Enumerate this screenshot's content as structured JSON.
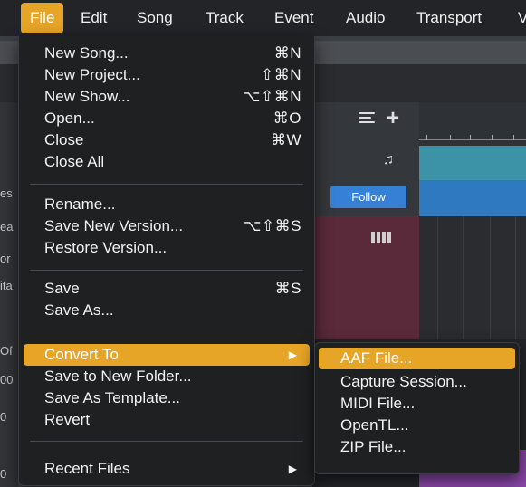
{
  "menubar": {
    "items": [
      "File",
      "Edit",
      "Song",
      "Track",
      "Event",
      "Audio",
      "Transport",
      "V"
    ],
    "active": "File"
  },
  "file_menu": {
    "items": [
      {
        "label": "New Song...",
        "shortcut": "⌘N"
      },
      {
        "label": "New Project...",
        "shortcut": "⇧⌘N"
      },
      {
        "label": "New Show...",
        "shortcut": "⌥⇧⌘N"
      },
      {
        "label": "Open...",
        "shortcut": "⌘O"
      },
      {
        "label": "Close",
        "shortcut": "⌘W"
      },
      {
        "label": "Close All",
        "shortcut": ""
      },
      {
        "label": "Rename...",
        "shortcut": ""
      },
      {
        "label": "Save New Version...",
        "shortcut": "⌥⇧⌘S"
      },
      {
        "label": "Restore Version...",
        "shortcut": ""
      },
      {
        "label": "Save",
        "shortcut": "⌘S"
      },
      {
        "label": "Save As...",
        "shortcut": ""
      },
      {
        "label": "Convert To",
        "shortcut": "",
        "submenu_arrow": "▶",
        "highlighted": true
      },
      {
        "label": "Save to New Folder...",
        "shortcut": ""
      },
      {
        "label": "Save As Template...",
        "shortcut": ""
      },
      {
        "label": "Revert",
        "shortcut": ""
      },
      {
        "label": "Recent Files",
        "shortcut": "",
        "submenu_arrow": "▶"
      }
    ]
  },
  "convert_submenu": {
    "items": [
      {
        "label": "AAF File...",
        "highlighted": true
      },
      {
        "label": "Capture Session..."
      },
      {
        "label": "MIDI File..."
      },
      {
        "label": "OpenTL..."
      },
      {
        "label": "ZIP File..."
      }
    ]
  },
  "background": {
    "follow_button": "Follow",
    "left_edge_fragments": [
      "es",
      "ea",
      "or",
      "ita",
      "Of",
      "00",
      "0",
      "0"
    ]
  },
  "colors": {
    "accent": "#e6a526",
    "menu_bg": "#1f2022",
    "follow_blue": "#3680d6",
    "lane_teal": "#3c93a8",
    "lane_blue": "#2f79c0",
    "maroon": "#5b2a3a",
    "purple": "#8a47a8"
  },
  "icons": [
    "list-icon",
    "plus-icon",
    "music-note-icon",
    "piano-keys-icon",
    "chevron-right-icon"
  ]
}
